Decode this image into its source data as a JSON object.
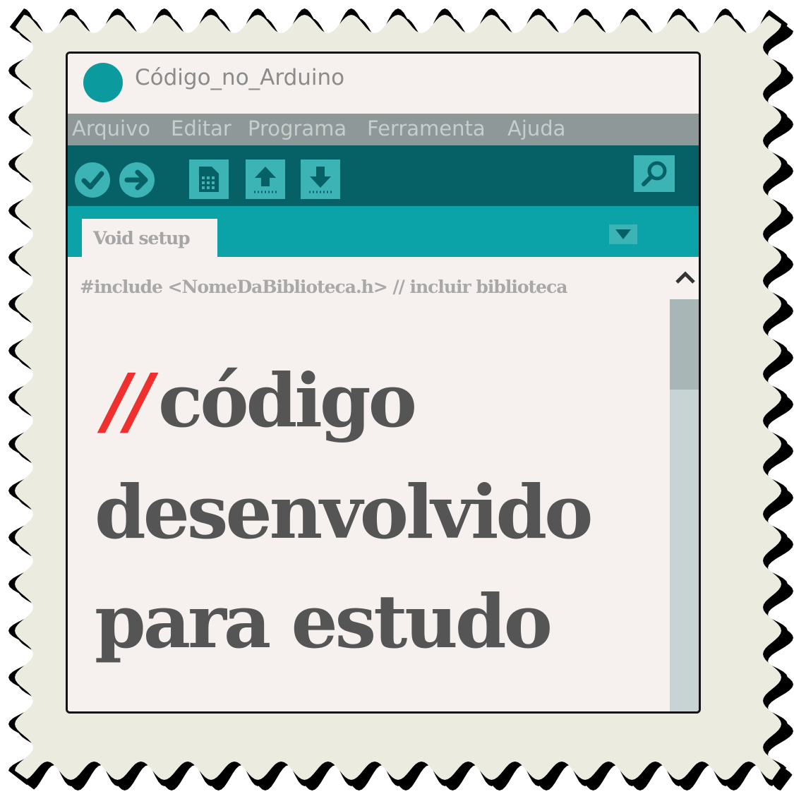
{
  "window": {
    "title": "Código_no_Arduino"
  },
  "menu": [
    "Arquivo",
    "Editar",
    "Programa",
    "Ferramenta",
    "Ajuda"
  ],
  "toolbar": {
    "buttons": [
      "verify-icon",
      "upload-icon",
      "new-icon",
      "open-icon",
      "save-icon",
      "serial-monitor-icon"
    ]
  },
  "tab": {
    "label": "Void setup"
  },
  "editor": {
    "include_line": "#include  <NomeDaBiblioteca.h>    // incluir biblioteca",
    "comment_slashes": "//",
    "line1": "código",
    "line2": "desenvolvido",
    "line3": "para estudo"
  },
  "colors": {
    "teal_dark": "#056165",
    "teal": "#0ba3a7",
    "accent_red": "#f02f2f",
    "text_dark": "#555555",
    "frame_fill": "#ecebdf",
    "frame_border": "#000000"
  }
}
